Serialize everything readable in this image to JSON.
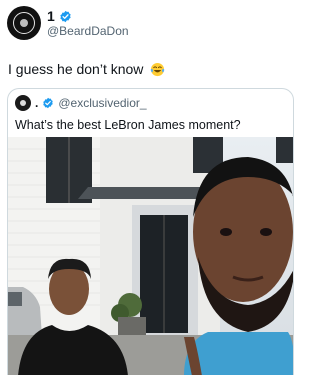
{
  "tweet": {
    "author": {
      "display_name": "1",
      "handle": "@BeardDaDon",
      "verified": true
    },
    "text": "I guess he don’t know",
    "emoji": "laughing-tears-emoji"
  },
  "quoted_tweet": {
    "handle": "@exclusivedior_",
    "separator": ".",
    "verified": true,
    "text": "What’s the best LeBron James moment?",
    "media": "video-frame"
  },
  "colors": {
    "text": "#0f1419",
    "secondary": "#536471",
    "verified": "#1d9bf0",
    "border": "#cfd9de"
  }
}
